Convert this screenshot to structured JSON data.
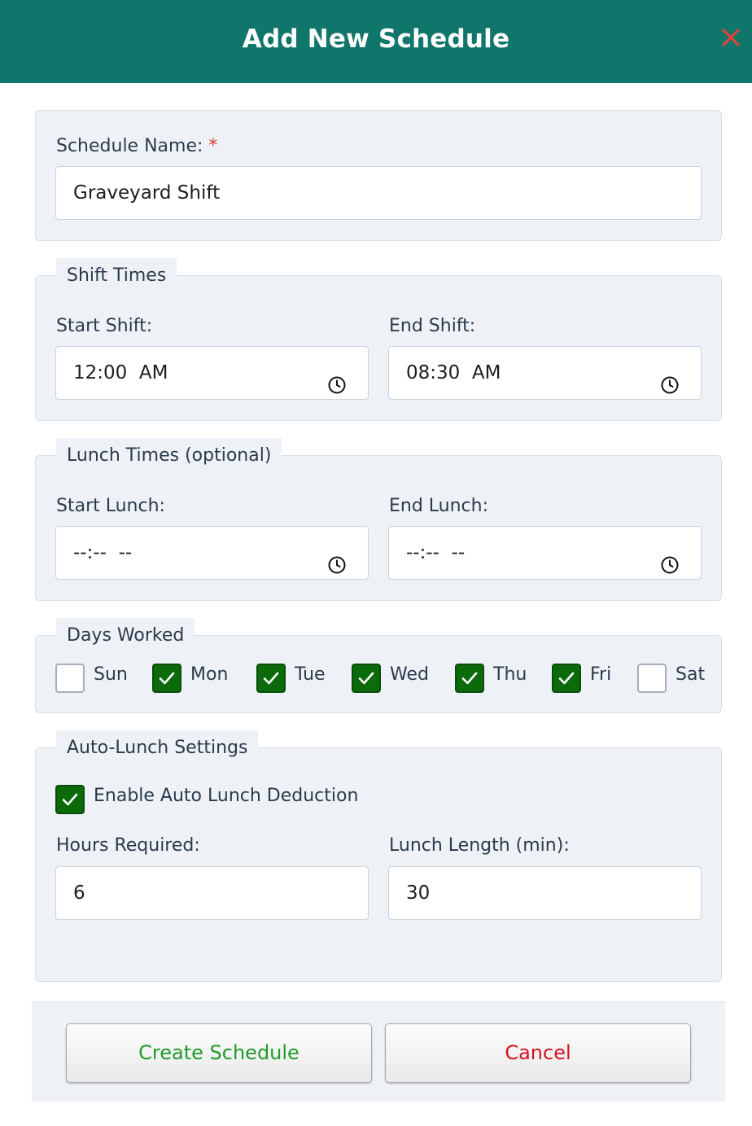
{
  "dialog": {
    "title": "Add New Schedule",
    "close_icon": "close-icon",
    "accent_color": "#10766b",
    "close_color": "#e0443a"
  },
  "schedule_name": {
    "label": "Schedule Name:",
    "required_marker": "*",
    "value": "Graveyard Shift"
  },
  "shift_times": {
    "legend": "Shift Times",
    "start_label": "Start Shift:",
    "start_value": "12:00  AM",
    "end_label": "End Shift:",
    "end_value": "08:30  AM",
    "icon": "clock-icon"
  },
  "lunch_times": {
    "legend": "Lunch Times (optional)",
    "start_label": "Start Lunch:",
    "start_value": "--:--  --",
    "end_label": "End Lunch:",
    "end_value": "--:--  --",
    "icon": "clock-icon"
  },
  "days_worked": {
    "legend": "Days Worked",
    "checked_color": "#0b6b0b",
    "days": [
      {
        "label": "Sun",
        "checked": false
      },
      {
        "label": "Mon",
        "checked": true
      },
      {
        "label": "Tue",
        "checked": true
      },
      {
        "label": "Wed",
        "checked": true
      },
      {
        "label": "Thu",
        "checked": true
      },
      {
        "label": "Fri",
        "checked": true
      },
      {
        "label": "Sat",
        "checked": false
      }
    ]
  },
  "auto_lunch": {
    "legend": "Auto-Lunch Settings",
    "enable_label": "Enable Auto Lunch Deduction",
    "enable_checked": true,
    "hours_label": "Hours Required:",
    "hours_value": "6",
    "length_label": "Lunch Length (min):",
    "length_value": "30"
  },
  "footer": {
    "create_label": "Create Schedule",
    "create_color": "#1f9b2a",
    "cancel_label": "Cancel",
    "cancel_color": "#d4121f"
  }
}
